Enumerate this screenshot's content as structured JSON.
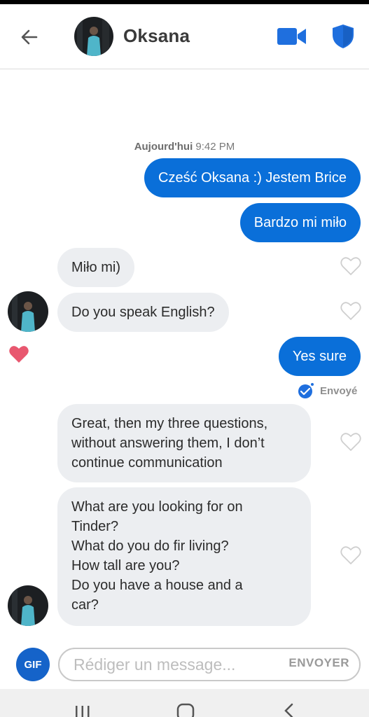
{
  "header": {
    "contact_name": "Oksana",
    "back_icon": "arrow-left-icon",
    "video_icon": "video-camera-icon",
    "safety_icon": "shield-icon"
  },
  "conversation": {
    "timestamp_day": "Aujourd'hui",
    "timestamp_time": "9:42 PM",
    "messages": [
      {
        "from": "me",
        "text": "Cześć Oksana :) Jestem Brice"
      },
      {
        "from": "me",
        "text": "Bardzo mi miło"
      },
      {
        "from": "them",
        "text": "Miło mi)"
      },
      {
        "from": "them",
        "text": "Do you speak English?"
      },
      {
        "from": "me",
        "text": "Yes sure",
        "liked": true
      },
      {
        "from": "them",
        "text": "Great, then my three questions, without answering them, I don’t continue communication"
      },
      {
        "from": "them",
        "lines": [
          "What are you looking for on",
          "Tinder?",
          "What do you do fir living?",
          "How tall are you?",
          "Do you have a house and a",
          "car?"
        ]
      }
    ],
    "sent_status": "Envoyé"
  },
  "composer": {
    "gif_label": "GIF",
    "placeholder": "Rédiger un message...",
    "send_label": "ENVOYER"
  },
  "colors": {
    "outgoing_bubble": "#0a6fd9",
    "incoming_bubble": "#eceef1",
    "like_heart": "#e8576f",
    "accent": "#1563c9"
  }
}
